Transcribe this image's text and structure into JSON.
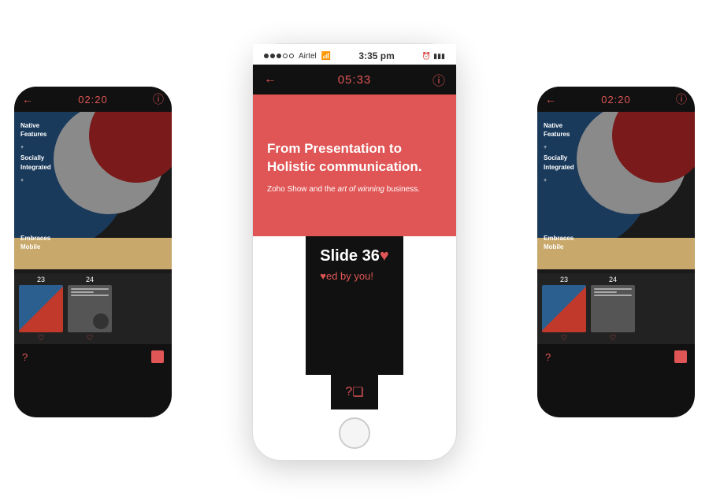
{
  "scene": {
    "bg": "#ffffff"
  },
  "left_phone": {
    "timer": "02:20",
    "slide_labels": {
      "native": "Native",
      "features": "Features",
      "plus1": "+",
      "socially": "Socially",
      "integrated": "Integrated",
      "plus2": "+",
      "embraces": "Embraces",
      "mobile": "Mobile"
    },
    "thumbs": [
      {
        "num": "23",
        "heart": "♡"
      },
      {
        "num": "24",
        "heart": "♡"
      }
    ],
    "bottom_icons": {
      "help": "?",
      "copy": ""
    }
  },
  "center_phone": {
    "status_bar": {
      "carrier": "Airtel",
      "time": "3:35 pm",
      "battery": "▮▮▮"
    },
    "timer": "05:33",
    "slide_heading": "From Presentation to Holistic communication.",
    "slide_subtext": "Zoho Show and the ",
    "slide_subtext_em": "art of winning",
    "slide_subtext_end": " business.",
    "info_label": "Slide 36",
    "heart_icon": "♥",
    "liked_text": "ed by you!",
    "liked_heart": "♥",
    "bottom_icons": {
      "help": "?",
      "copy": "❏"
    }
  },
  "right_phone": {
    "timer": "02:20",
    "slide_labels": {
      "native": "Native",
      "features": "Features",
      "plus1": "+",
      "socially": "Socially",
      "integrated": "Integrated",
      "plus2": "+",
      "embraces": "Embraces",
      "mobile": "Mobile"
    },
    "thumbs": [
      {
        "num": "23",
        "heart": "♡"
      },
      {
        "num": "24",
        "heart": "♡"
      }
    ],
    "bottom_icons": {
      "help": "?",
      "copy": ""
    }
  },
  "icons": {
    "back_arrow": "←",
    "info": "ⓘ",
    "heart_filled": "♥",
    "heart_empty": "♡",
    "question": "?",
    "copy": "❏"
  }
}
